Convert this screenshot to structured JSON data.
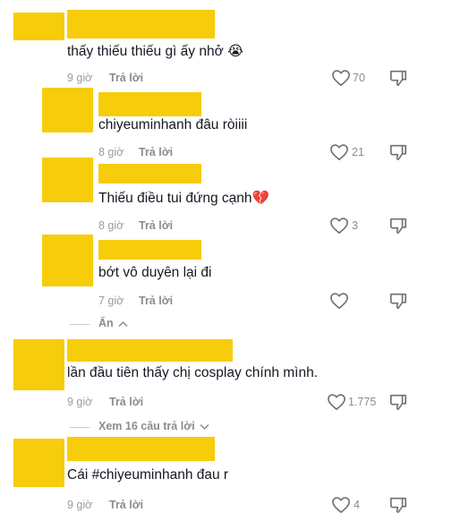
{
  "comments": [
    {
      "text": "thấy thiếu thiếu gì ấy nhở 😭",
      "time": "9 giờ",
      "reply_label": "Trả lời",
      "likes": "70"
    },
    {
      "text": "chiyeuminhanh đâu ròiiii",
      "time": "8 giờ",
      "reply_label": "Trả lời",
      "likes": "21"
    },
    {
      "text": "Thiếu điều tui đứng cạnh💔",
      "time": "8 giờ",
      "reply_label": "Trả lời",
      "likes": "3"
    },
    {
      "text": "bớt vô duyên lại đi",
      "time": "7 giờ",
      "reply_label": "Trả lời",
      "likes": ""
    },
    {
      "text": "lần đầu tiên thấy chị cosplay chính mình.",
      "time": "9 giờ",
      "reply_label": "Trả lời",
      "likes": "1.775"
    },
    {
      "text": "Cái #chiyeuminhanh đau r",
      "time": "9 giờ",
      "reply_label": "Trả lời",
      "likes": "4"
    }
  ],
  "hide_replies_label": "Ẩn",
  "view_replies_label": "Xem 16 câu trả lời",
  "icons": {
    "like": "heart-outline-icon",
    "dislike": "thumbs-down-icon",
    "collapse": "chevron-up-icon",
    "expand": "chevron-down-icon"
  },
  "colors": {
    "redaction": "#f7cc0a",
    "text": "#161823",
    "muted": "#8a8b91"
  }
}
